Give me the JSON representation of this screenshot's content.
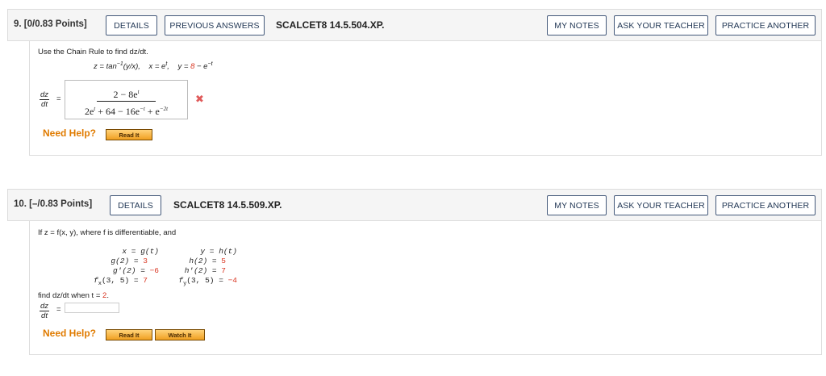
{
  "q9": {
    "number": "9.  [0/0.83 Points]",
    "details": "DETAILS",
    "prev_answers": "PREVIOUS ANSWERS",
    "code": "SCALCET8 14.5.504.XP.",
    "my_notes": "MY NOTES",
    "ask_teacher": "ASK YOUR TEACHER",
    "practice": "PRACTICE ANOTHER",
    "prompt": "Use the Chain Rule to find dz/dt.",
    "eq_z": "z = tan",
    "eq_z_sup": "−1",
    "eq_z_tail": "(y/x),",
    "eq_x": "x = e",
    "eq_x_sup": "t",
    "eq_x_tail": ",",
    "eq_y": "y = ",
    "eq_y_red": "8",
    "eq_y_tail": " − e",
    "eq_y_sup": "−t",
    "dz": "dz",
    "dt": "dt",
    "equals": "=",
    "answer_num": "2 − 8e",
    "answer_num_sup": "t",
    "answer_den_1": "2e",
    "answer_den_sup1": "t",
    "answer_den_2": " + 64 − 16e",
    "answer_den_sup2": "−t",
    "answer_den_3": " + e",
    "answer_den_sup3": "−2t",
    "status_mark": "✖",
    "need_help": "Need Help?",
    "read_it": "Read It"
  },
  "q10": {
    "number": "10.  [–/0.83 Points]",
    "details": "DETAILS",
    "code": "SCALCET8 14.5.509.XP.",
    "my_notes": "MY NOTES",
    "ask_teacher": "ASK YOUR TEACHER",
    "practice": "PRACTICE ANOTHER",
    "prompt": "If z = f(x, y), where f is differentiable, and",
    "left_col": [
      {
        "lhs": "x = g(t)",
        "val": ""
      },
      {
        "lhs": "g(2) = ",
        "val": "3"
      },
      {
        "lhs": "g'(2) = ",
        "val": "−6"
      },
      {
        "lhs": "f",
        "sub": "x",
        "lhs2": "(3, 5) = ",
        "val": "7"
      }
    ],
    "right_col": [
      {
        "lhs": "y = h(t)",
        "val": ""
      },
      {
        "lhs": "h(2) = ",
        "val": "5"
      },
      {
        "lhs": "h'(2) = ",
        "val": "7"
      },
      {
        "lhs": "f",
        "sub": "y",
        "lhs2": "(3, 5) = ",
        "val": "−4"
      }
    ],
    "find_text": "find dz/dt when t = ",
    "find_val": "2",
    "find_end": ".",
    "dz": "dz",
    "dt": "dt",
    "equals": "=",
    "answer_value": "",
    "need_help": "Need Help?",
    "read_it": "Read It",
    "watch_it": "Watch It"
  }
}
